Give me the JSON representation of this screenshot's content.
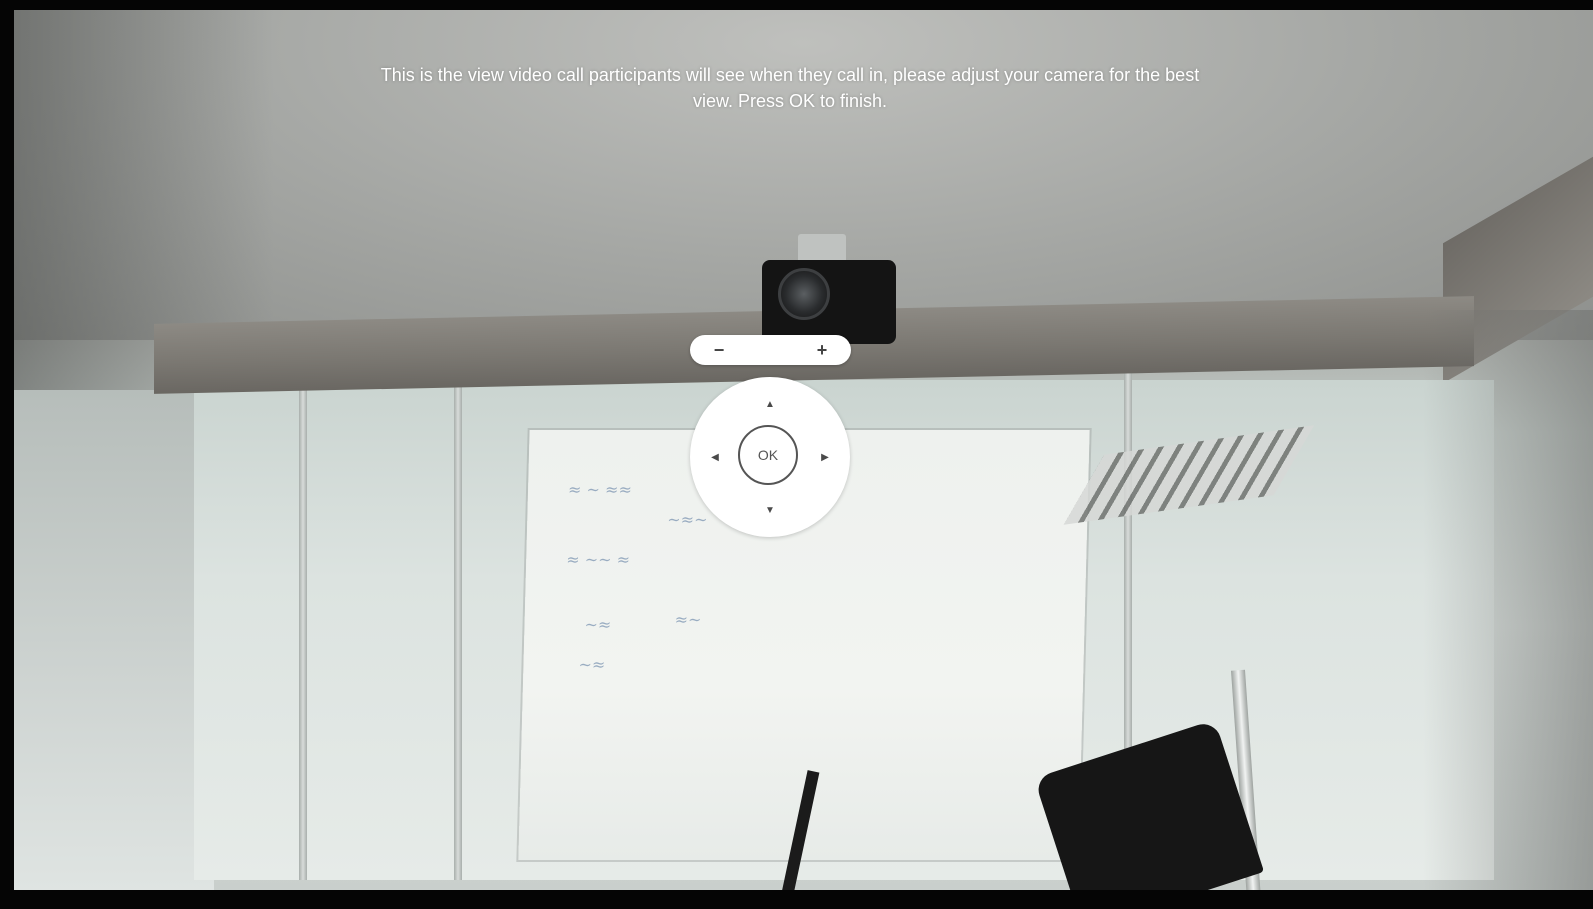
{
  "instruction": {
    "line1": "This is the view video call participants will see when they call in, please adjust your camera for the best",
    "line2": "view. Press OK to finish."
  },
  "zoom": {
    "minus_label": "−",
    "plus_label": "+",
    "minus_icon": "zoom-out-icon",
    "plus_icon": "zoom-in-icon"
  },
  "dpad": {
    "ok_label": "OK",
    "up_icon": "▲",
    "down_icon": "▼",
    "left_icon": "◀",
    "right_icon": "▶"
  },
  "colors": {
    "overlay_text": "#ffffff",
    "control_bg": "#ffffff",
    "control_fg": "#4a4a4a"
  }
}
